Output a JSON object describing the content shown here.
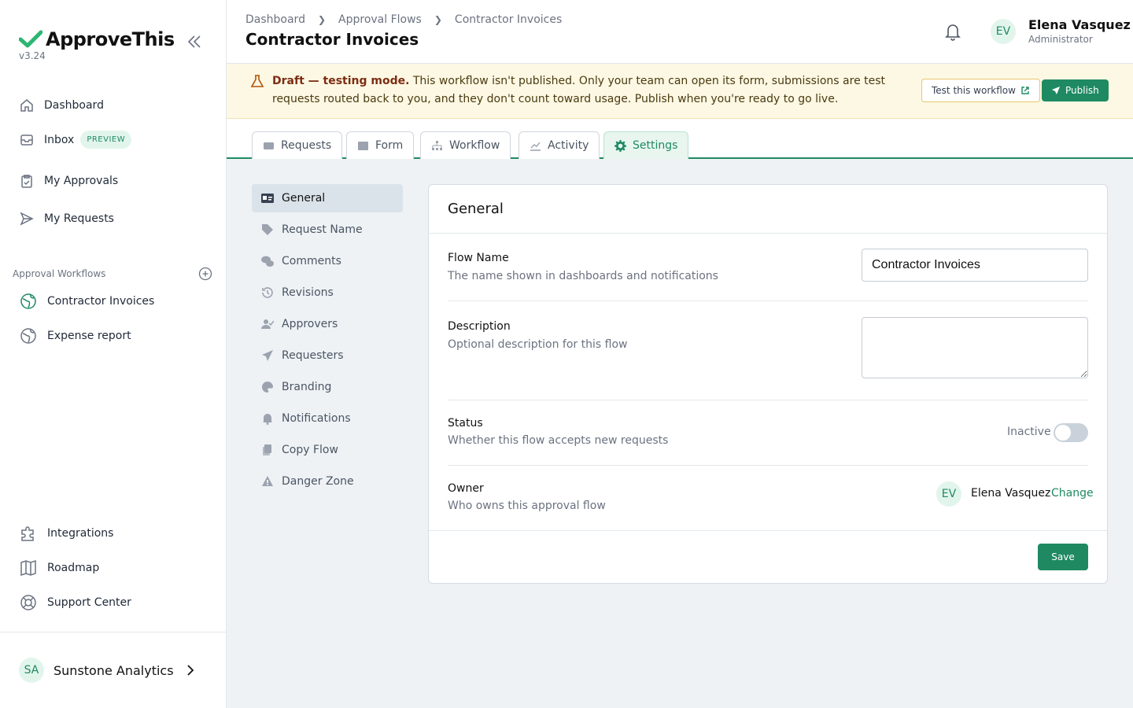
{
  "app": {
    "name": "ApproveThis",
    "version": "v3.24"
  },
  "sidebar": {
    "nav": [
      {
        "label": "Dashboard"
      },
      {
        "label": "Inbox",
        "badge": "PREVIEW"
      },
      {
        "label": "My Approvals"
      },
      {
        "label": "My Requests"
      }
    ],
    "section_label": "Approval Workflows",
    "workflows": [
      {
        "label": "Contractor Invoices"
      },
      {
        "label": "Expense report"
      }
    ],
    "bottom": [
      {
        "label": "Integrations"
      },
      {
        "label": "Roadmap"
      },
      {
        "label": "Support Center"
      }
    ],
    "org": {
      "initials": "SA",
      "name": "Sunstone Analytics"
    }
  },
  "header": {
    "breadcrumb": [
      "Dashboard",
      "Approval Flows",
      "Contractor Invoices"
    ],
    "title": "Contractor Invoices",
    "user": {
      "initials": "EV",
      "name": "Elena Vasquez",
      "role": "Administrator"
    }
  },
  "banner": {
    "strong": "Draft — testing mode.",
    "text": " This workflow isn't published. Only your team can open its form, submissions are test requests routed back to you, and they don't count toward usage. Publish when you're ready to go live.",
    "test_button": "Test this workflow",
    "publish_button": "Publish"
  },
  "tabs": [
    {
      "label": "Requests"
    },
    {
      "label": "Form"
    },
    {
      "label": "Workflow"
    },
    {
      "label": "Activity"
    },
    {
      "label": "Settings",
      "active": true
    }
  ],
  "settings_nav": [
    {
      "label": "General",
      "active": true
    },
    {
      "label": "Request Name"
    },
    {
      "label": "Comments"
    },
    {
      "label": "Revisions"
    },
    {
      "label": "Approvers"
    },
    {
      "label": "Requesters"
    },
    {
      "label": "Branding"
    },
    {
      "label": "Notifications"
    },
    {
      "label": "Copy Flow"
    },
    {
      "label": "Danger Zone"
    }
  ],
  "general": {
    "title": "General",
    "flow_name": {
      "label": "Flow Name",
      "help": "The name shown in dashboards and notifications",
      "value": "Contractor Invoices"
    },
    "description": {
      "label": "Description",
      "help": "Optional description for this flow",
      "value": ""
    },
    "status": {
      "label": "Status",
      "help": "Whether this flow accepts new requests",
      "value": "Inactive"
    },
    "owner": {
      "label": "Owner",
      "help": "Who owns this approval flow",
      "initials": "EV",
      "name": "Elena Vasquez",
      "change": "Change"
    },
    "save": "Save"
  },
  "colors": {
    "accent": "#1f8a62",
    "banner_bg": "#fdf8e4",
    "page_bg": "#eef2f5"
  }
}
